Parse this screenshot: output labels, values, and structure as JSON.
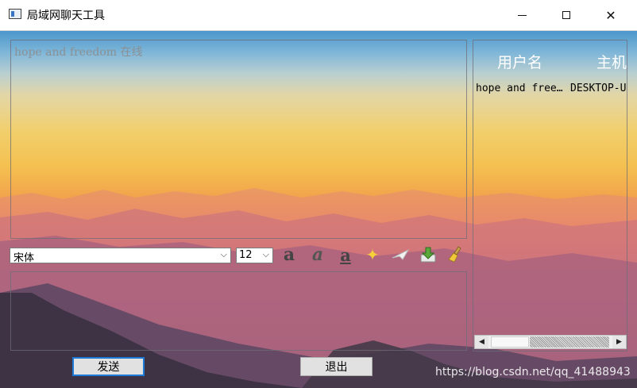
{
  "window": {
    "title": "局域网聊天工具",
    "minimize_glyph": "—",
    "maximize_glyph": "☐",
    "close_glyph": "✕"
  },
  "chat": {
    "history_line": "hope and freedom 在线"
  },
  "users_table": {
    "headers": [
      "用户名",
      "主机"
    ],
    "rows": [
      {
        "username": "hope and free…",
        "host": "DESKTOP-U"
      }
    ]
  },
  "format_toolbar": {
    "font_family": "宋体",
    "font_size": "12",
    "bold_icon": "a",
    "italic_icon": "a",
    "underline_icon": "a",
    "icons": [
      "bold-icon",
      "italic-icon",
      "underline-icon",
      "color-icon",
      "send-file-icon",
      "save-icon",
      "clear-icon"
    ]
  },
  "buttons": {
    "send_label": "发送",
    "exit_label": "退出"
  },
  "watermark": "https://blog.csdn.net/qq_41488943",
  "colors": {
    "send_focus": "#1c79d6",
    "color_icon": "#f5d23a",
    "save_icon": "#5aa83a"
  }
}
